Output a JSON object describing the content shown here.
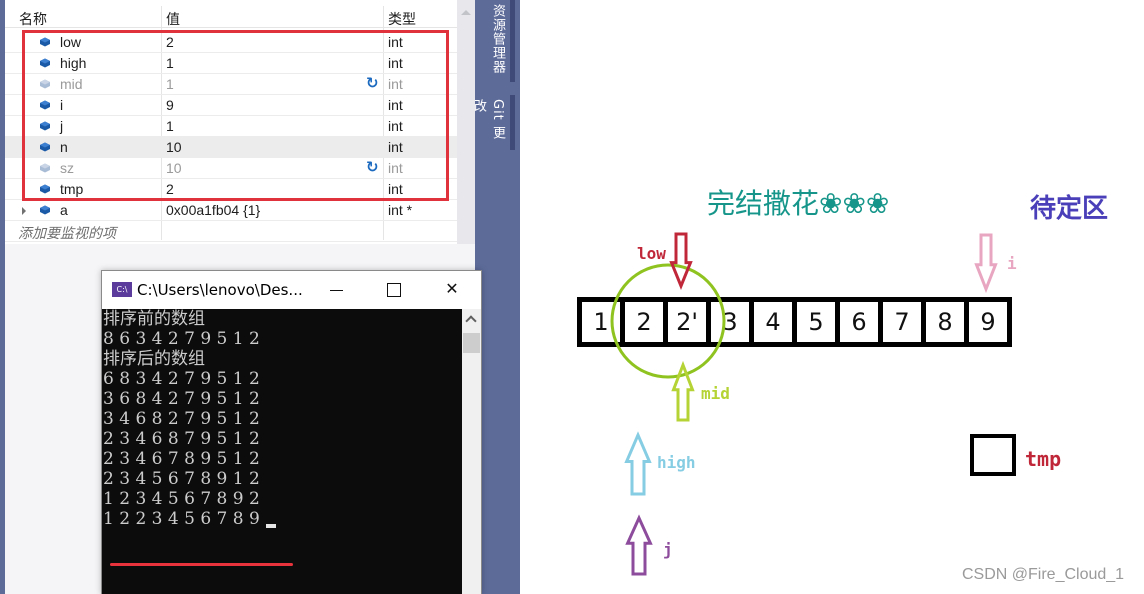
{
  "watch": {
    "columns": {
      "name": "名称",
      "value": "值",
      "type": "类型"
    },
    "rows": [
      {
        "name": "low",
        "value": "2",
        "type": "int",
        "stale": false
      },
      {
        "name": "high",
        "value": "1",
        "type": "int",
        "stale": false
      },
      {
        "name": "mid",
        "value": "1",
        "type": "int",
        "stale": true
      },
      {
        "name": "i",
        "value": "9",
        "type": "int",
        "stale": false
      },
      {
        "name": "j",
        "value": "1",
        "type": "int",
        "stale": false
      },
      {
        "name": "n",
        "value": "10",
        "type": "int",
        "stale": false
      },
      {
        "name": "sz",
        "value": "10",
        "type": "int",
        "stale": true
      },
      {
        "name": "tmp",
        "value": "2",
        "type": "int",
        "stale": false
      },
      {
        "name": "a",
        "value": "0x00a1fb04 {1}",
        "type": "int *",
        "stale": false
      }
    ],
    "add_placeholder": "添加要监视的项"
  },
  "side_tabs": {
    "explorer": "解决方案资源管理器",
    "explorer_visible": "资源管理器",
    "git": "Git 更改"
  },
  "console": {
    "title": "C:\\Users\\lenovo\\Des...",
    "icon_text": "C:\\",
    "lines": [
      "排序前的数组",
      "8 6 3 4 2 7 9 5 1 2",
      "排序后的数组",
      "6 8 3 4 2 7 9 5 1 2",
      "3 6 8 4 2 7 9 5 1 2",
      "3 4 6 8 2 7 9 5 1 2",
      "2 3 4 6 8 7 9 5 1 2",
      "2 3 4 6 7 8 9 5 1 2",
      "2 3 4 5 6 7 8 9 1 2",
      "1 2 3 4 5 6 7 8 9 2",
      "1 2 2 3 4 5 6 7 8 9"
    ]
  },
  "diagram": {
    "title_done": "完结撒花❀❀❀",
    "title_pending": "待定区",
    "array": [
      "1",
      "2",
      "2'",
      "3",
      "4",
      "5",
      "6",
      "7",
      "8",
      "9"
    ],
    "pointers": {
      "low": "low",
      "mid": "mid",
      "high": "high",
      "j": "j",
      "i": "i",
      "tmp": "tmp"
    },
    "colors": {
      "low": "#c0283a",
      "mid": "#b5d334",
      "high": "#86cde3",
      "j": "#8d4c9c",
      "i": "#e8a6c0",
      "tmp": "#c0283a",
      "circle": "#8fc31f"
    }
  },
  "watermark": "CSDN @Fire_Cloud_1"
}
